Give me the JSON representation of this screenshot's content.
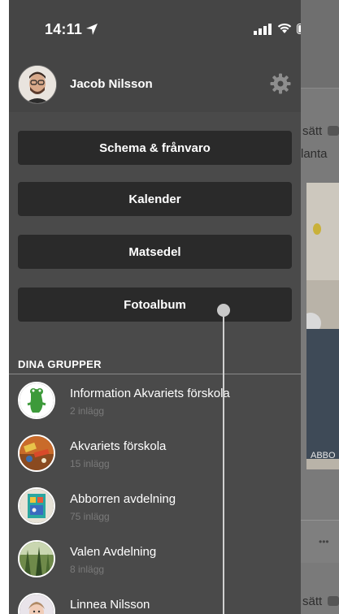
{
  "status_bar": {
    "time": "14:11"
  },
  "profile": {
    "name": "Jacob Nilsson"
  },
  "menu": [
    {
      "label": "Schema & frånvaro"
    },
    {
      "label": "Kalender"
    },
    {
      "label": "Matsedel"
    },
    {
      "label": "Fotoalbum"
    }
  ],
  "groups_title": "DINA GRUPPER",
  "groups": [
    {
      "name": "Information Akvariets förskola",
      "count": "2 inlägg"
    },
    {
      "name": "Akvariets förskola",
      "count": "15 inlägg"
    },
    {
      "name": "Abborren avdelning",
      "count": "75 inlägg"
    },
    {
      "name": "Valen Avdelning",
      "count": "8 inlägg"
    },
    {
      "name": "Linnea Nilsson",
      "count": ""
    }
  ],
  "background": {
    "text_1": "sätt",
    "text_2": "lanta",
    "photo_caption": "ABBO",
    "text_3": "sätt"
  },
  "colors": {
    "drawer": "#4a4a4a",
    "button": "#2a2a2a",
    "text": "#ffffff",
    "muted": "#7a7a7a"
  }
}
